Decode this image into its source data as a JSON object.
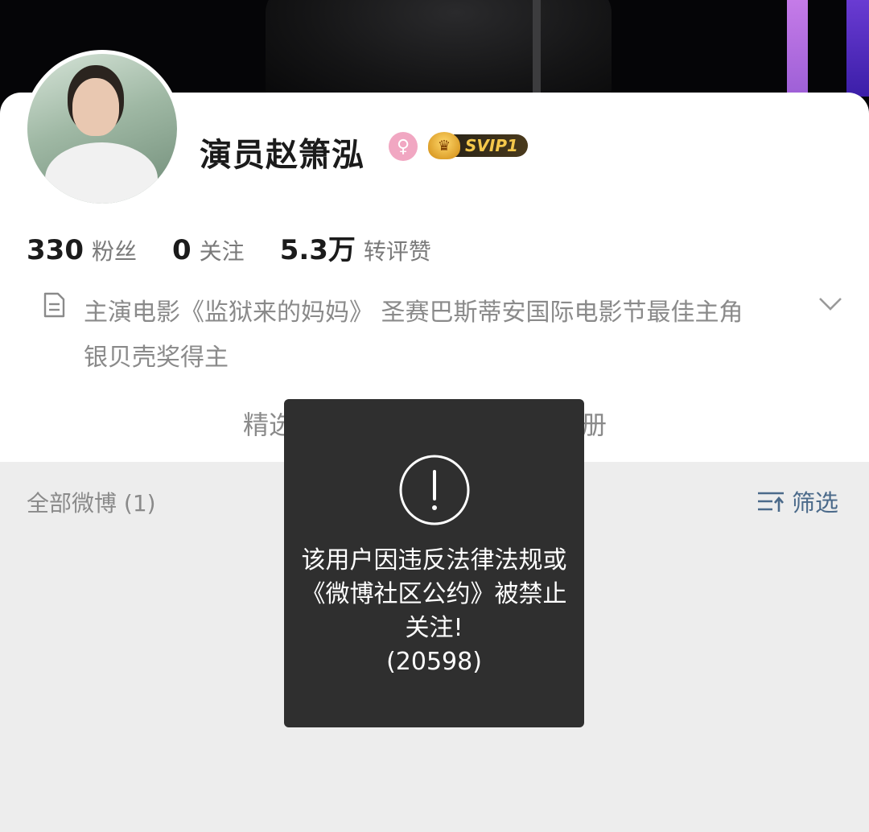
{
  "profile": {
    "name": "演员赵箫泓",
    "gender_icon": "female-icon",
    "vip_badge": "SVIP1"
  },
  "stats": {
    "followers": {
      "value": "330",
      "label": "粉丝"
    },
    "following": {
      "value": "0",
      "label": "关注"
    },
    "engagement": {
      "value": "5.3万",
      "label": "转评赞"
    }
  },
  "bio": {
    "text": "主演电影《监狱来的妈妈》 圣赛巴斯蒂安国际电影节最佳主角银贝壳奖得主"
  },
  "tabs": {
    "featured_partial": "精选",
    "album_partial": "相册"
  },
  "feed": {
    "count_label": "全部微博 (1)",
    "filter_label": "筛选"
  },
  "toast": {
    "icon": "exclamation-circle-icon",
    "message": "该用户因违反法律法规或《微博社区公约》被禁止关注!",
    "code": "(20598)"
  },
  "colors": {
    "toast_bg": "#2f2f2f",
    "filter_text": "#4b6a8a",
    "vip_gold": "#f5c84b",
    "gender_pink": "#f1a7c2"
  }
}
